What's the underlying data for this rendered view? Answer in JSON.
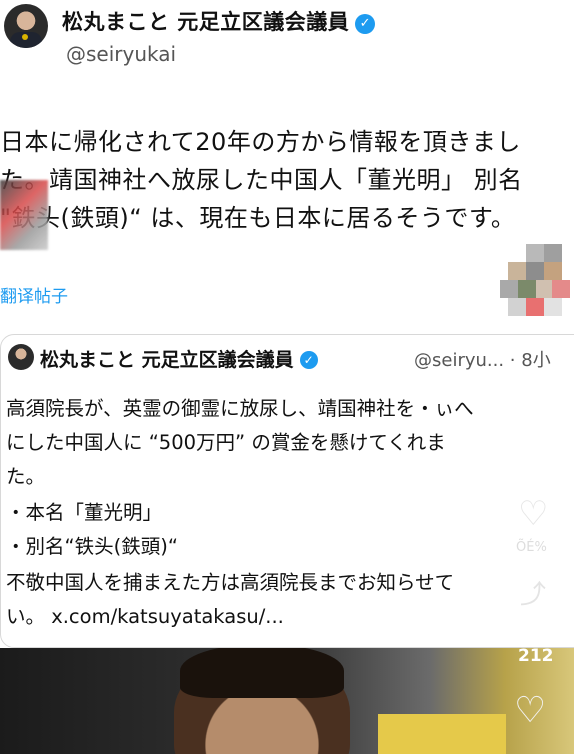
{
  "header": {
    "name": "松丸まこと 元足立区議会議員",
    "handle": "@seiryukai"
  },
  "main_text": [
    "日本に帰化されて20年の方から情報を頂きまし",
    "た。靖国神社へ放尿した中国人「董光明」 別名",
    "\"鉄头(鉄頭)“ は、現在も日本に居るそうです。"
  ],
  "translate_label": "翻译帖子",
  "quoted": {
    "name": "松丸まこと 元足立区議会議員",
    "handle_time": "@seiryu... · 8小",
    "lines": [
      "高須院長が、英霊の御霊に放尿し、靖国神社を・ぃへ",
      "にした中国人に “500万円” の賞金を懸けてくれま",
      "た。",
      "・本名「董光明」",
      "・別名“铁头(鉄頭)“",
      "不敬中国人を捕まえた方は高須院長までお知らせて",
      "い。 x.com/katsuyatakasu/..."
    ]
  },
  "overlay": {
    "count_top": "212",
    "count_faint": "ÕÉ%"
  },
  "icons": {
    "verified": "verified-badge-icon",
    "heart": "heart-icon"
  },
  "colors": {
    "accent": "#1d9bf0",
    "text": "#111111",
    "muted": "#555555"
  }
}
